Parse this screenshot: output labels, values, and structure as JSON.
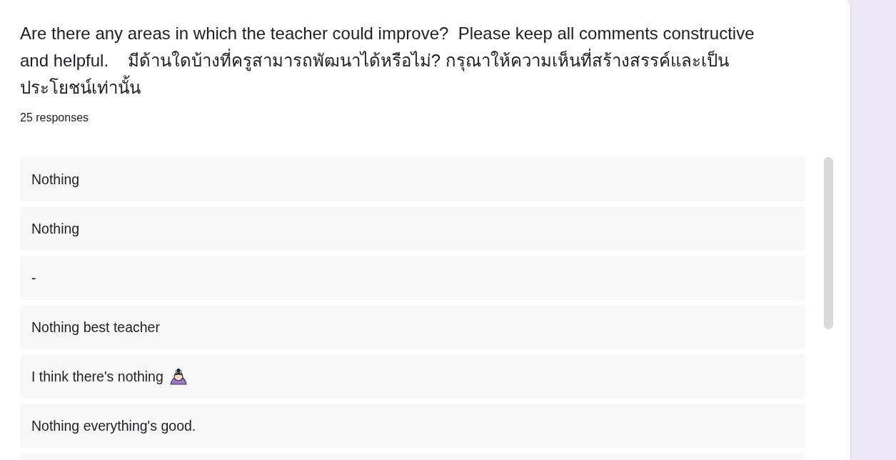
{
  "question": {
    "title": "Are there any areas in which the teacher could improve?  Please keep all comments constructive and helpful.    มีด้านใดบ้างที่ครูสามารถพัฒนาได้หรือไม่? กรุณาให้ความเห็นที่สร้างสรรค์และเป็นประโยชน์เท่านั้น",
    "response_count": "25 responses"
  },
  "responses": [
    {
      "text": "Nothing",
      "emoji": false
    },
    {
      "text": "Nothing",
      "emoji": false
    },
    {
      "text": "-",
      "emoji": false
    },
    {
      "text": "Nothing best teacher",
      "emoji": false
    },
    {
      "text": "I think there's nothing",
      "emoji": true
    },
    {
      "text": "Nothing everything's good.",
      "emoji": false
    }
  ]
}
